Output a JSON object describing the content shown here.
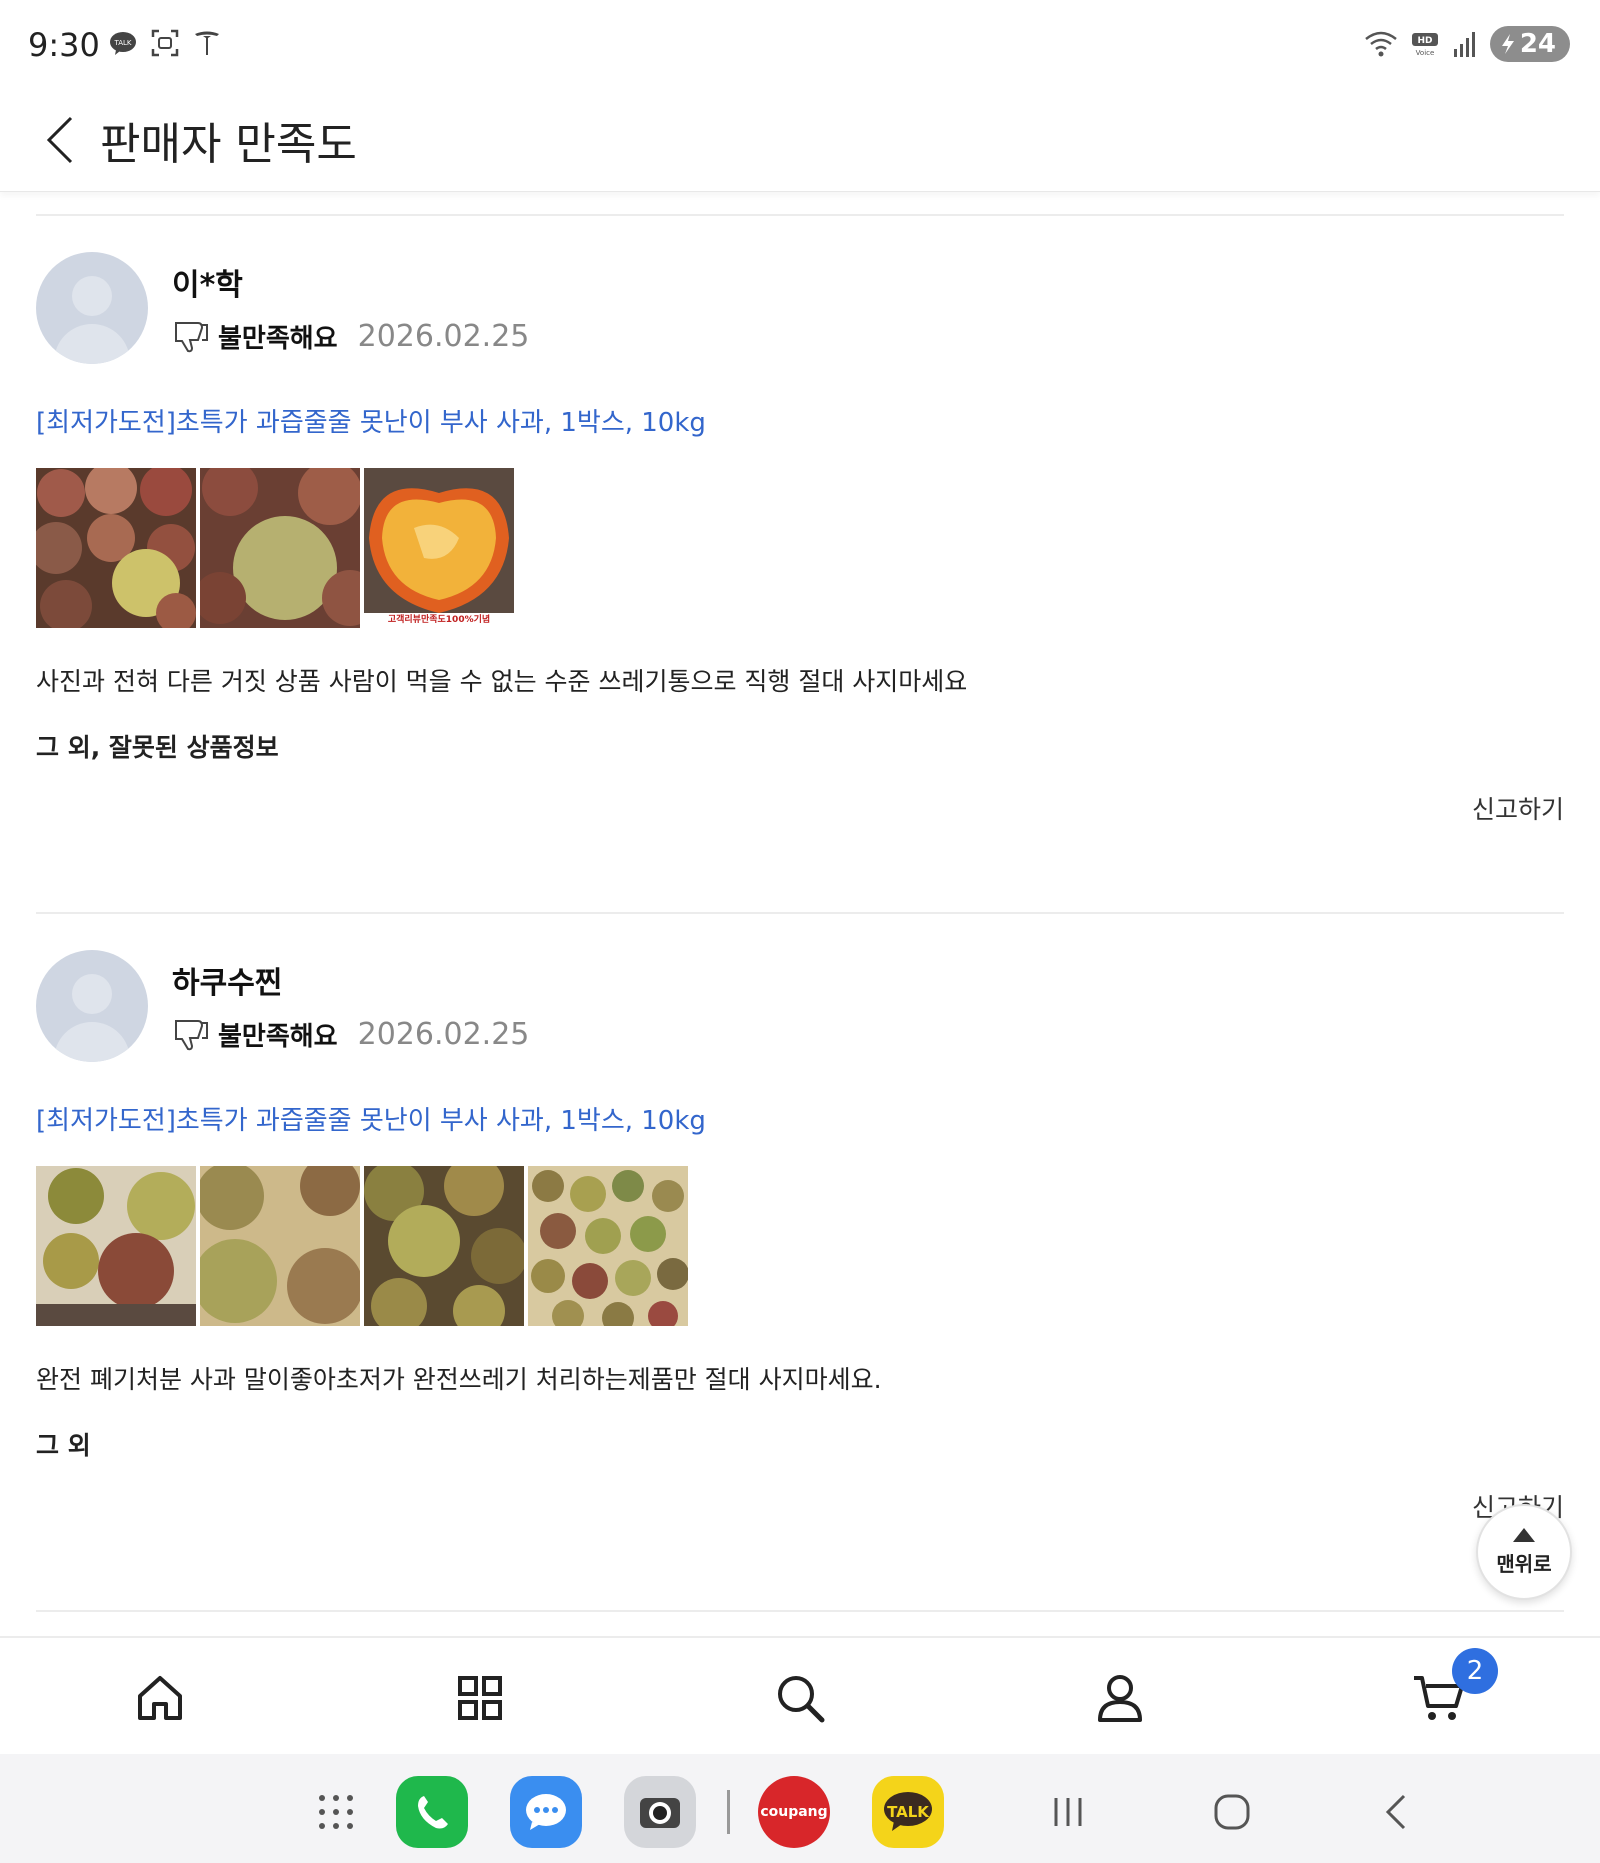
{
  "status_bar": {
    "time": "9:30",
    "battery": "24",
    "left_icons": [
      "talk-notification-icon",
      "screenshot-icon",
      "tesla-icon"
    ],
    "right_icons": [
      "wifi-icon",
      "hd-voice-icon",
      "signal-icon",
      "battery-icon"
    ]
  },
  "header": {
    "title": "판매자 만족도"
  },
  "reviews": [
    {
      "reviewer": "이*학",
      "rating_label": "불만족해요",
      "date": "2026.02.25",
      "product": "[최저가도전]초특가 과즙줄줄 못난이 부사 사과, 1박스, 10kg",
      "photo_count": 3,
      "photo_caption": "고객리뷰만족도100%기념",
      "text": "사진과 전혀 다른 거짓 상품 사람이 먹을 수 없는 수준 쓰레기통으로 직행 절대 사지마세요",
      "issue": "그 외, 잘못된 상품정보",
      "report": "신고하기"
    },
    {
      "reviewer": "하쿠수찐",
      "rating_label": "불만족해요",
      "date": "2026.02.25",
      "product": "[최저가도전]초특가 과즙줄줄 못난이 부사 사과, 1박스, 10kg",
      "photo_count": 4,
      "text": "완전 폐기처분 사과 말이좋아초저가 완전쓰레기 처리하는제품만 절대 사지마세요.",
      "issue": "그 외",
      "report": "신고하기"
    }
  ],
  "top_button": {
    "label": "맨위로"
  },
  "bottom_nav": {
    "items": [
      "home-icon",
      "category-icon",
      "search-icon",
      "profile-icon",
      "cart-icon"
    ],
    "cart_count": "2"
  },
  "dock": {
    "coupang_label": "coupang",
    "talk_label": "TALK"
  },
  "colors": {
    "link": "#3366cc",
    "badge": "#2f6fe0",
    "avatar": "#cfd6e2"
  }
}
